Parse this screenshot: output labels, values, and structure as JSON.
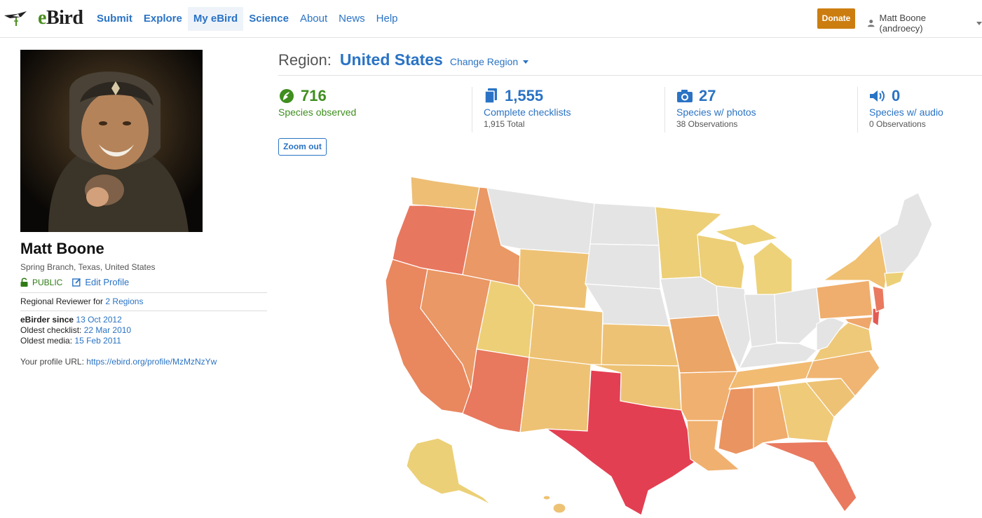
{
  "header": {
    "logo": {
      "e": "e",
      "bird": "Bird"
    },
    "nav": [
      {
        "label": "Submit",
        "bold": true,
        "active": false
      },
      {
        "label": "Explore",
        "bold": true,
        "active": false
      },
      {
        "label": "My eBird",
        "bold": true,
        "active": true
      },
      {
        "label": "Science",
        "bold": true,
        "active": false
      },
      {
        "label": "About",
        "bold": false,
        "active": false
      },
      {
        "label": "News",
        "bold": false,
        "active": false
      },
      {
        "label": "Help",
        "bold": false,
        "active": false
      }
    ],
    "donate_label": "Donate",
    "user_label": "Matt Boone (androecy)"
  },
  "profile": {
    "name": "Matt Boone",
    "location": "Spring Branch, Texas, United States",
    "visibility": "PUBLIC",
    "edit_label": "Edit Profile",
    "reviewer_prefix": "Regional Reviewer for",
    "reviewer_link": "2 Regions",
    "ebirder_since_label": "eBirder since",
    "ebirder_since": "13 Oct 2012",
    "oldest_checklist_label": "Oldest checklist:",
    "oldest_checklist": "22 Mar 2010",
    "oldest_media_label": "Oldest media:",
    "oldest_media": "15 Feb 2011",
    "url_label": "Your profile URL:",
    "url": "https://ebird.org/profile/MzMzNzYw"
  },
  "region": {
    "label": "Region:",
    "name": "United States",
    "change_label": "Change Region"
  },
  "stats": [
    {
      "icon": "species-icon",
      "value": "716",
      "label": "Species observed",
      "sub": "",
      "color": "#3f8e1f"
    },
    {
      "icon": "checklist-icon",
      "value": "1,555",
      "label": "Complete checklists",
      "sub": "1,915 Total",
      "color": "#2a73c4"
    },
    {
      "icon": "camera-icon",
      "value": "27",
      "label": "Species w/ photos",
      "sub": "38 Observations",
      "color": "#2a73c4"
    },
    {
      "icon": "speaker-icon",
      "value": "0",
      "label": "Species w/ audio",
      "sub": "0 Observations",
      "color": "#2a73c4"
    }
  ],
  "zoom_label": "Zoom out",
  "colors": {
    "accent": "#2a73c4",
    "green": "#3f8e1f",
    "donate": "#cc7d0f",
    "map_high": "#e33f52",
    "map_midhigh": "#e8775f",
    "map_mid": "#eb9a68",
    "map_midlow": "#f0b06f",
    "map_low": "#eec57a",
    "map_lowest": "#ecd077",
    "map_none": "#e4e4e4"
  }
}
